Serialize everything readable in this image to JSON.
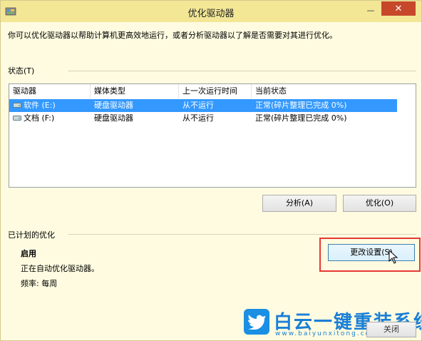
{
  "window": {
    "title": "优化驱动器",
    "minimize_glyph": "—",
    "close_glyph": "✕"
  },
  "intro": "你可以优化驱动器以帮助计算机更高效地运行，或者分析驱动器以了解是否需要对其进行优化。",
  "status": {
    "label": "状态(T)",
    "columns": [
      "驱动器",
      "媒体类型",
      "上一次运行时间",
      "当前状态"
    ],
    "rows": [
      {
        "drive": "软件 (E:)",
        "media": "硬盘驱动器",
        "last_run": "从不运行",
        "status": "正常(碎片整理已完成 0%)",
        "selected": true
      },
      {
        "drive": "文档 (F:)",
        "media": "硬盘驱动器",
        "last_run": "从不运行",
        "status": "正常(碎片整理已完成 0%)",
        "selected": false
      }
    ]
  },
  "buttons": {
    "analyze": "分析(A)",
    "optimize": "优化(O)",
    "change_settings": "更改设置(S)",
    "close": "关闭"
  },
  "scheduled": {
    "label": "已计划的优化",
    "state": "启用",
    "description": "正在自动优化驱动器。",
    "frequency": "频率: 每周"
  },
  "watermark": {
    "title": "白云一键重装系统",
    "url": "www.baiyunxitong.com"
  },
  "colors": {
    "title_bar": "#f3e796",
    "client_bg": "#fefbe0",
    "selection": "#3399ff",
    "close_button": "#c7472b",
    "highlight_box": "#e53935",
    "watermark_blue": "#1a7fd6"
  }
}
